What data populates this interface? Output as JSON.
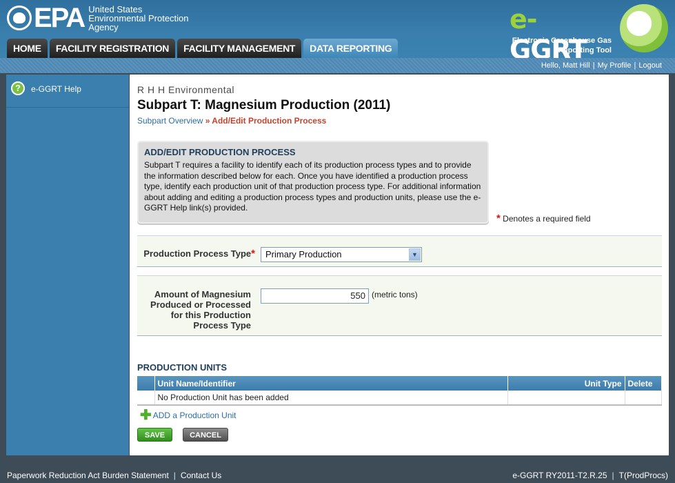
{
  "header": {
    "epa_word": "EPA",
    "epa_agency_lines": [
      "United States",
      "Environmental Protection",
      "Agency"
    ],
    "ggrt_title_e": "e-",
    "ggrt_title_rest": "GGRT",
    "ggrt_subtitle_1": "Electronic Greenhouse Gas",
    "ggrt_subtitle_2": "Reporting Tool"
  },
  "tabs": [
    {
      "label": "HOME"
    },
    {
      "label": "FACILITY REGISTRATION"
    },
    {
      "label": "FACILITY MANAGEMENT"
    },
    {
      "label": "DATA REPORTING"
    }
  ],
  "userbar": {
    "greeting": "Hello, Matt Hill",
    "profile": "My Profile",
    "logout": "Logout"
  },
  "sidebar": {
    "help_label": "e-GGRT Help",
    "help_icon": "?"
  },
  "main": {
    "facility": "R H H Environmental",
    "title": "Subpart T: Magnesium Production (2011)",
    "breadcrumb_link": "Subpart Overview",
    "breadcrumb_sep": " » ",
    "breadcrumb_current": "Add/Edit Production Process",
    "info_title": "ADD/EDIT PRODUCTION PROCESS",
    "info_body": "Subpart T requires a facility to identify each of its production process types and to provide the information described below for each. Once you have identified a production process type, identify each production unit of that production process type. For additional information about adding and editing a production process types and production units, please use the e-GGRT Help link(s) provided.",
    "required_star": "*",
    "required_note": " Denotes a required field",
    "ptype_label": "Production Process Type",
    "ptype_value": "Primary Production",
    "amount_label": "Amount of Magnesium Produced or Processed for this Production Process Type",
    "amount_value": "550",
    "amount_unit": "(metric tons)",
    "units_title": "PRODUCTION UNITS",
    "units_columns": [
      "",
      "Unit Name/Identifier",
      "Unit Type",
      "Delete"
    ],
    "units_empty": "No Production Unit has been added",
    "add_unit": "ADD a Production Unit",
    "save": "SAVE",
    "cancel": "CANCEL"
  },
  "footer": {
    "burden": "Paperwork Reduction Act Burden Statement",
    "contact": "Contact Us",
    "version": "e-GGRT RY2011-T2.R.25",
    "code": "T(ProdProcs)"
  }
}
